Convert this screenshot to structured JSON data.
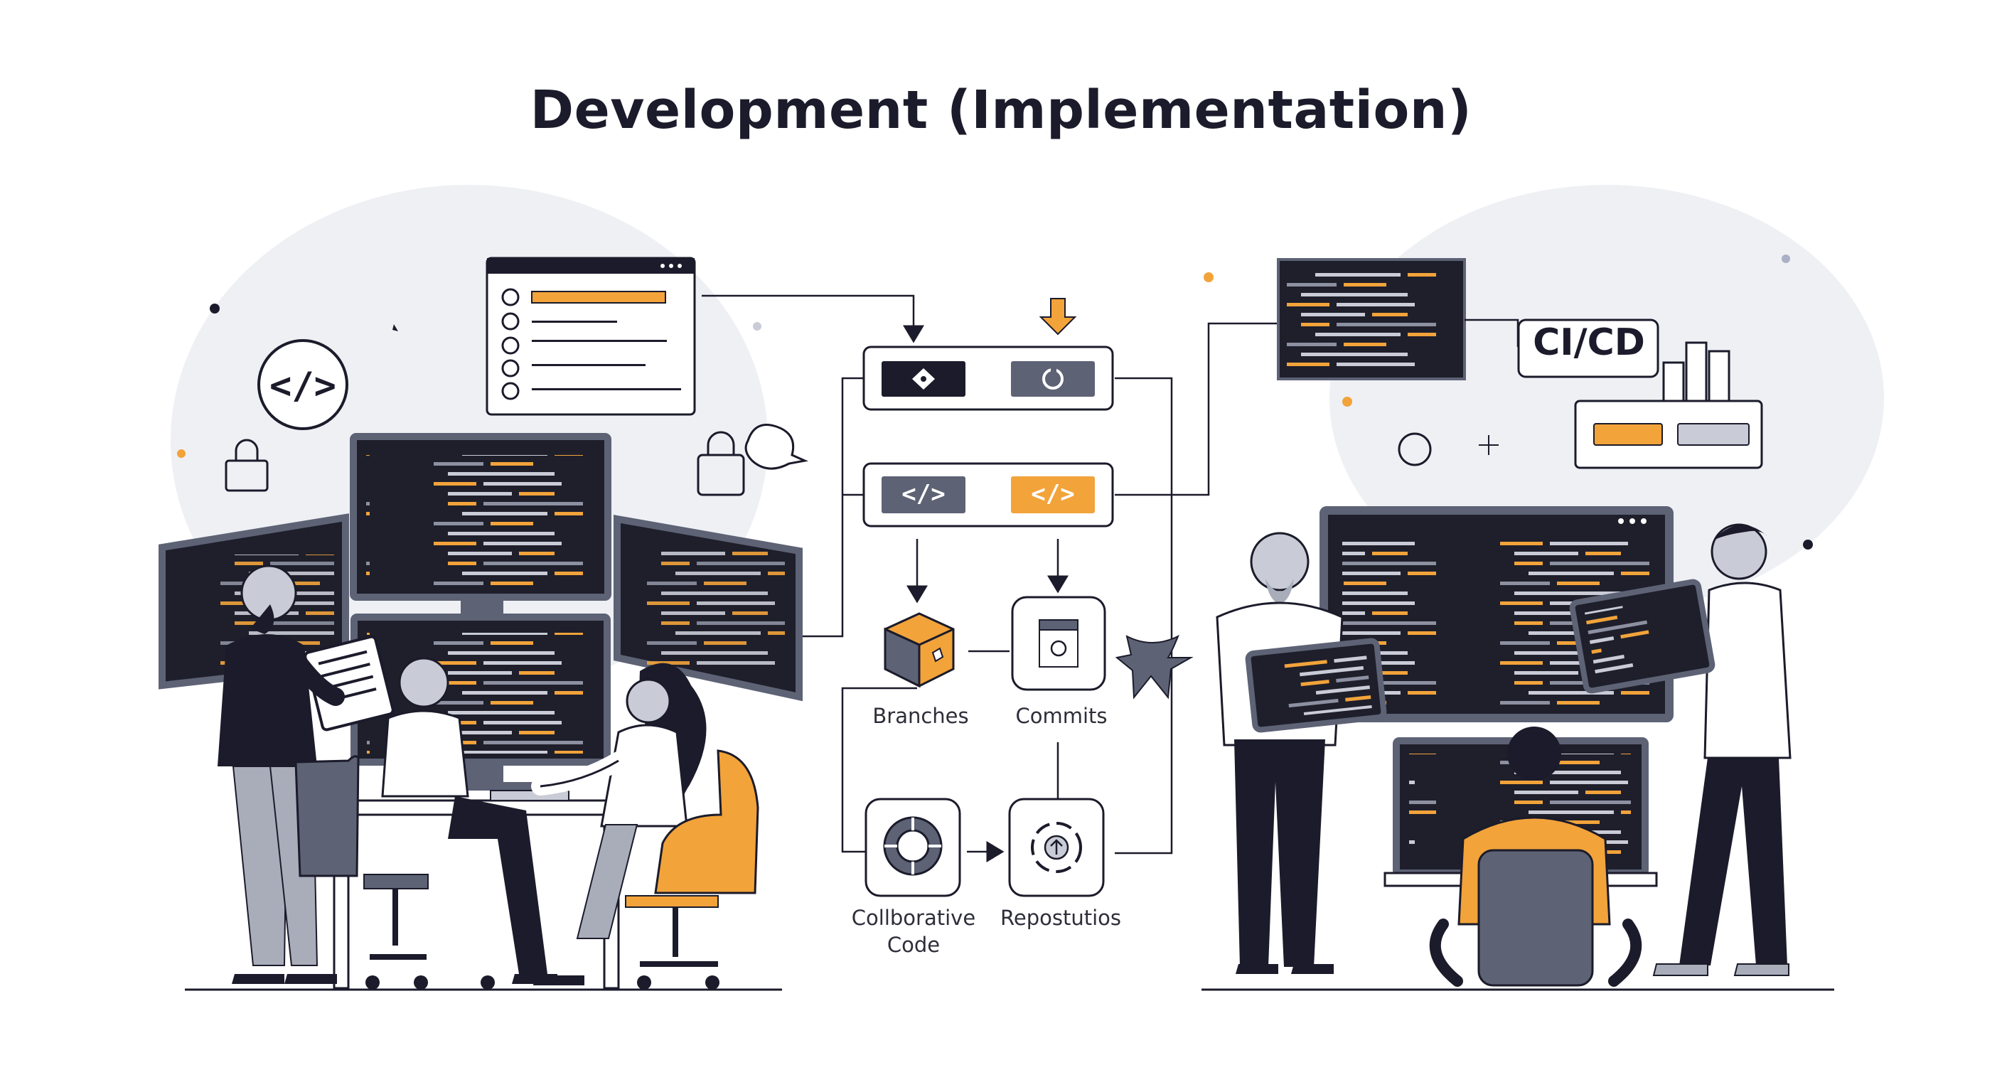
{
  "title": "Development (Implementation)",
  "labels": {
    "branches": "Branches",
    "commits": "Commits",
    "collab_line1": "Collborative",
    "collab_line2": "Code",
    "repos": "Repostutios",
    "cicd": "CI/CD",
    "code_badge": "</>"
  },
  "colors": {
    "ink": "#1b1b2b",
    "slate": "#5d6275",
    "orange": "#f2a33a",
    "light_gray": "#eef0f4",
    "screen": "#1e1f2b"
  }
}
